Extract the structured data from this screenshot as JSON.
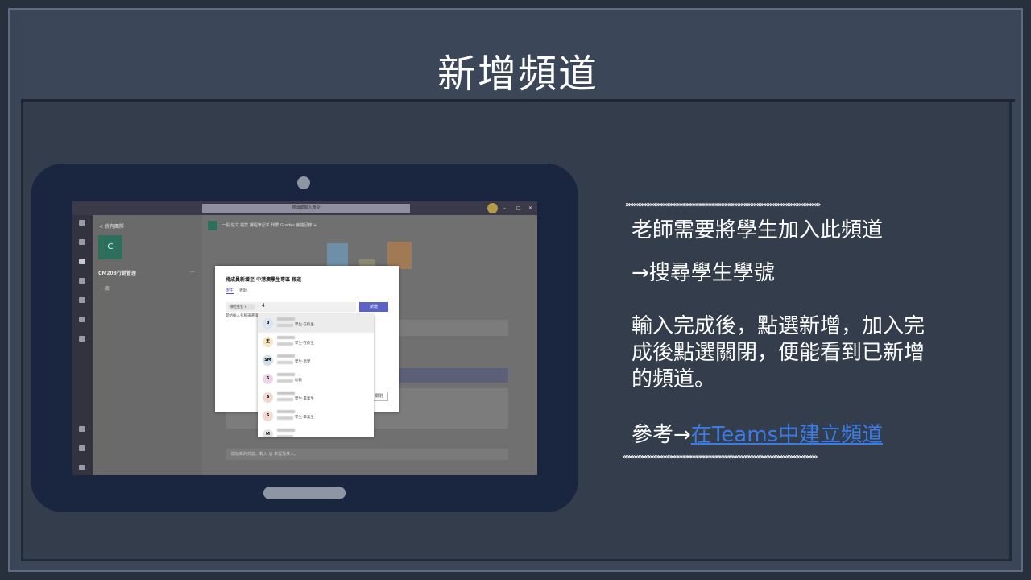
{
  "slide": {
    "title": "新增頻道"
  },
  "teams": {
    "search_placeholder": "搜尋或輸入命令",
    "window_controls": [
      "–",
      "□",
      "✕"
    ],
    "back_label": "< 所有團隊",
    "team_initial": "C",
    "team_name": "CM203行銷管理",
    "team_more": "...",
    "channel_general": "一般",
    "tabs": "一般   貼文   檔案   課程筆記本   作業   Grades   會議記錄 +",
    "compose_placeholder": "開始新的交談。輸入 @ 來提及某人。",
    "dialog": {
      "title": "將成員新增至 中港澳學生專區 頻道",
      "tab_students": "學生",
      "tab_teachers": "老師",
      "chip_label": "學生姓名 ×",
      "caret": "4",
      "add_button": "新增",
      "hint": "開始輸入名稱來選擇",
      "close_button": "關閉"
    },
    "suggestions": [
      {
        "initials": "B",
        "tag": "學生·在校生",
        "color": "#d7e4f2"
      },
      {
        "initials": "王",
        "tag": "學生·在校生",
        "color": "#f7e6c4"
      },
      {
        "initials": "SM",
        "tag": "學生·退學",
        "color": "#cfe0ea"
      },
      {
        "initials": "S",
        "tag": "助教",
        "color": "#ecd5e6"
      },
      {
        "initials": "S",
        "tag": "學生·畢業生",
        "color": "#f3d9d2"
      },
      {
        "initials": "S",
        "tag": "學生·畢業生",
        "color": "#f3d9d2"
      },
      {
        "initials": "M",
        "tag": "",
        "color": "#e2e2e2"
      }
    ]
  },
  "panel": {
    "arrows_top": "»»»»»»»»»»»»»»»»»»»»»»»»»»»»»»»»»»»»»»»»»»»»»»»»»»»»»»»»»»»»",
    "line1": "老師需要將學生加入此頻道",
    "line2": "→搜尋學生學號",
    "line3": "輸入完成後，點選新增，加入完",
    "line4": "成後點選關閉，便能看到已新增",
    "line5": "的頻道。",
    "ref_prefix": "參考→",
    "ref_link": "在Teams中建立頻道",
    "arrows_bottom": "»»»»»»»»»»»»»»»»»»»»»»»»»»»»»»»»»»»»»»»»»»»»»»»»»»»»»»»»»»»»"
  }
}
